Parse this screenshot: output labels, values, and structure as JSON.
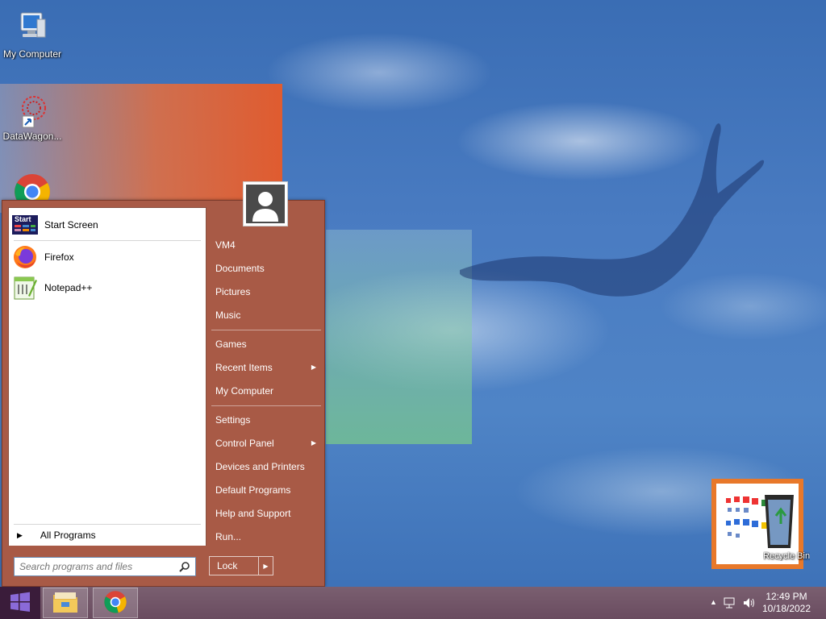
{
  "desktop": {
    "icons": [
      {
        "label": "My Computer",
        "icon": "computer-icon"
      },
      {
        "label": "DataWagon...",
        "icon": "datawagon-shortcut-icon"
      },
      {
        "label": "",
        "icon": "chrome-icon"
      },
      {
        "label": "Recycle Bin",
        "icon": "recycle-bin-icon"
      }
    ]
  },
  "start_menu": {
    "pinned": [
      {
        "label": "Start Screen",
        "icon": "start-screen-icon"
      },
      {
        "label": "Firefox",
        "icon": "firefox-icon"
      },
      {
        "label": "Notepad++",
        "icon": "notepadpp-icon"
      }
    ],
    "start_screen_icon_text": "Start",
    "all_programs": "All Programs",
    "search_placeholder": "Search programs and files",
    "right_items": {
      "vm4": "VM4",
      "documents": "Documents",
      "pictures": "Pictures",
      "music": "Music",
      "games": "Games",
      "recent_items": "Recent Items",
      "my_computer": "My Computer",
      "settings": "Settings",
      "control_panel": "Control Panel",
      "devices_printers": "Devices and Printers",
      "default_programs": "Default Programs",
      "help_support": "Help and Support",
      "run": "Run..."
    },
    "lock_label": "Lock",
    "accent_color": "#a85a46"
  },
  "taskbar": {
    "buttons": [
      {
        "icon": "windows-logo-icon"
      },
      {
        "icon": "file-explorer-icon"
      },
      {
        "icon": "chrome-icon"
      }
    ],
    "clock": {
      "time": "12:49 PM",
      "date": "10/18/2022"
    },
    "tray_icons": [
      "show-hidden-icons-icon",
      "network-icon",
      "volume-icon"
    ]
  }
}
